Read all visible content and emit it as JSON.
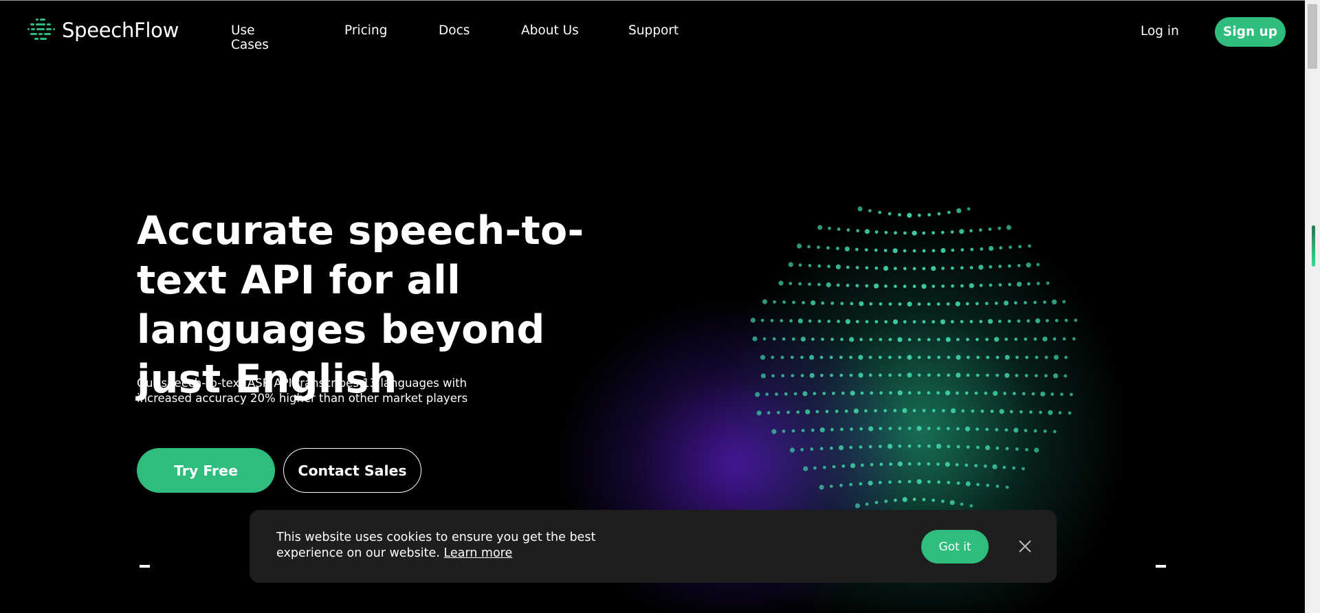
{
  "header": {
    "brand": "SpeechFlow",
    "nav": [
      "Use Cases",
      "Pricing",
      "Docs",
      "About Us",
      "Support"
    ],
    "login": "Log in",
    "signup": "Sign up"
  },
  "hero": {
    "title": "Accurate speech-to-text API for all languages beyond just English",
    "subtitle": "Our speech-to-text ASR API transcribes 13 languages with increased accuracy 20% higher than other market players",
    "try_free": "Try Free",
    "contact_sales": "Contact Sales"
  },
  "cookie": {
    "text": "This website uses cookies to ensure you get the best experience on our website.",
    "learn_more": "Learn more",
    "got_it": "Got it",
    "close_icon": "close-icon"
  },
  "colors": {
    "accent": "#2ebd7d",
    "background": "#000000",
    "cookie_bg": "#1e1e1e",
    "globe_dots": "#3ec9a0"
  },
  "icons": [
    "speechflow-logo-icon",
    "globe-dots-graphic",
    "close-icon"
  ]
}
